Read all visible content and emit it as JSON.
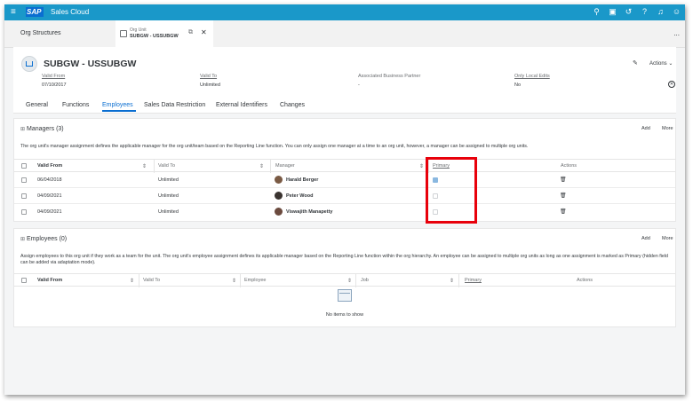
{
  "shell": {
    "brand": "Sales Cloud",
    "logo_text": "SAP",
    "icons": [
      "search-icon",
      "chat-icon",
      "history-icon",
      "help-icon",
      "notifications-icon",
      "user-icon"
    ]
  },
  "tabs": {
    "first": "Org Structures",
    "active_caption": "Org Unit",
    "active_name": "SUBGW - USSUBGW",
    "more": "..."
  },
  "header": {
    "title": "SUBGW - USSUBGW",
    "actions": "Actions ⌄",
    "attrs": [
      {
        "label": "Valid From",
        "value": "07/10/2017"
      },
      {
        "label": "Valid To",
        "value": "Unlimited"
      },
      {
        "label": "Associated Business Partner",
        "value": "-"
      },
      {
        "label": "Only Local Edits",
        "value": "No"
      }
    ]
  },
  "nav": [
    "General",
    "Functions",
    "Employees",
    "Sales Data Restriction",
    "External Identifiers",
    "Changes"
  ],
  "managers": {
    "title": "Managers",
    "count": "(3)",
    "add": "Add",
    "more": "More",
    "desc": "The org unit's manager assignment defines the applicable manager for the org unit/team based on the Reporting Line function. You can only assign one manager at a time to an org unit, however, a manager can be assigned to multiple org units.",
    "columns": [
      "Valid From",
      "Valid To",
      "Manager",
      "Primary",
      "Actions"
    ],
    "rows": [
      {
        "from": "06/04/2018",
        "to": "Unlimited",
        "manager": "Harald Berger",
        "primary": true
      },
      {
        "from": "04/09/2021",
        "to": "Unlimited",
        "manager": "Peter Wood",
        "primary": false
      },
      {
        "from": "04/09/2021",
        "to": "Unlimited",
        "manager": "Viswajith Manapetty",
        "primary": false
      }
    ]
  },
  "employees": {
    "title": "Employees",
    "count": "(0)",
    "add": "Add",
    "more": "More",
    "desc": "Assign employees to this org unit if they work as a team for the unit. The org unit's employee assignment defines its applicable manager based on the Reporting Line function within the org hierarchy. An employee can be assigned to multiple org units as long as one assignment is marked as Primary (hidden field can be added via adaptation mode).",
    "columns": [
      "Valid From",
      "Valid To",
      "Employee",
      "Job",
      "Primary",
      "Actions"
    ],
    "empty": "No items to show"
  }
}
